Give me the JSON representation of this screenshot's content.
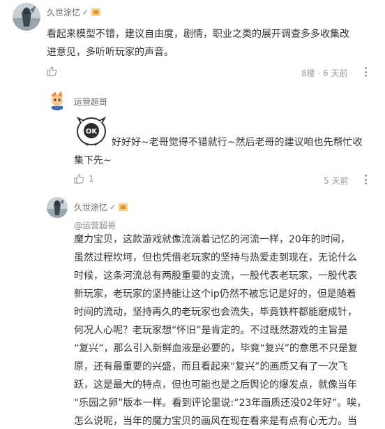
{
  "comment1": {
    "user": "久世涂忆",
    "verify": "✓",
    "lines": [
      "看起来模型不错，建议自由度，剧情，职业之类的展开调查多多收集改",
      "进意见，多听听玩家的声音。"
    ],
    "meta": "8楼 · 6 天前",
    "more_icon": "more-dots-icon",
    "like_icon": "thumbs-up-icon"
  },
  "reply1": {
    "user": "运营超哥",
    "sticker_label": "OK",
    "lines": [
      "好好好~老哥觉得不错就行~然后老哥的建议咱也先帮忙收",
      "集下先~"
    ],
    "like_count": "1",
    "meta": "5 天前"
  },
  "reply2": {
    "user": "久世涂忆",
    "verify": "✓",
    "mention": "@运营超哥",
    "lines": [
      "魔力宝贝，这款游戏就像流淌着记忆的河流一样，20年的时间，",
      "虽然过程坎坷，但也凭借老玩家的坚持与热爱走到现在，无论什么",
      "时候，这条河流总有两股重要的支流，一股代表老玩家，一股代表",
      "新玩家，老玩家的坚持能让这个ip仍然不被忘记是好的，但是随着",
      "时间的流动，坚持再久的老玩家也会流失，毕竟铁杵都能磨成针，",
      "何况人心呢？老玩家想“怀旧”是肯定的。不过既然游戏的主旨是",
      "“复兴”，那么引入新鲜血液是必要的，毕竟“复兴”的意思不只是复",
      "原，还有最重要的兴盛，而且看起来“复兴”的画质又有了一次飞",
      "跃，这是最大的特点，但也可能也是之后舆论的爆发点，就像当年",
      "“乐园之卵”版本一样。看到评论里说:“23年画质还没02年好”。唉，",
      "怎么说呢，当年的魔力宝贝的画风在现在看来是有点有心无力。当"
    ]
  },
  "colors": {
    "text": "#333333",
    "name": "#666666",
    "meta": "#9a9a9a",
    "background": "#ffffff"
  }
}
